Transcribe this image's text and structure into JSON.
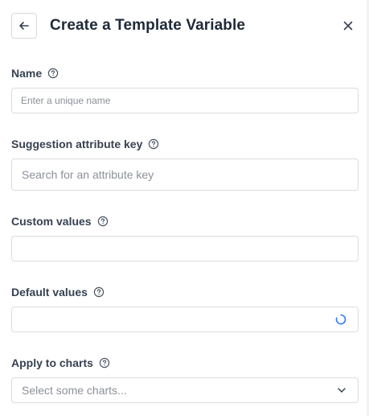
{
  "dialog": {
    "title": "Create a Template Variable"
  },
  "fields": {
    "name": {
      "label": "Name",
      "placeholder": "Enter a unique name",
      "value": ""
    },
    "suggestion_key": {
      "label": "Suggestion attribute key",
      "placeholder": "Search for an attribute key",
      "value": ""
    },
    "custom_values": {
      "label": "Custom values",
      "value": ""
    },
    "default_values": {
      "label": "Default values",
      "value": "",
      "loading": true
    },
    "apply_to_charts": {
      "label": "Apply to charts",
      "placeholder": "Select some charts..."
    }
  },
  "icons": {
    "back": "arrow-left-icon",
    "close": "close-icon",
    "help": "help-circle-icon",
    "spinner": "loading-spinner-icon",
    "chevron": "chevron-down-icon"
  },
  "colors": {
    "spinner": "#2f7bf5",
    "border": "#d9dce1",
    "placeholder": "#8b9099"
  }
}
